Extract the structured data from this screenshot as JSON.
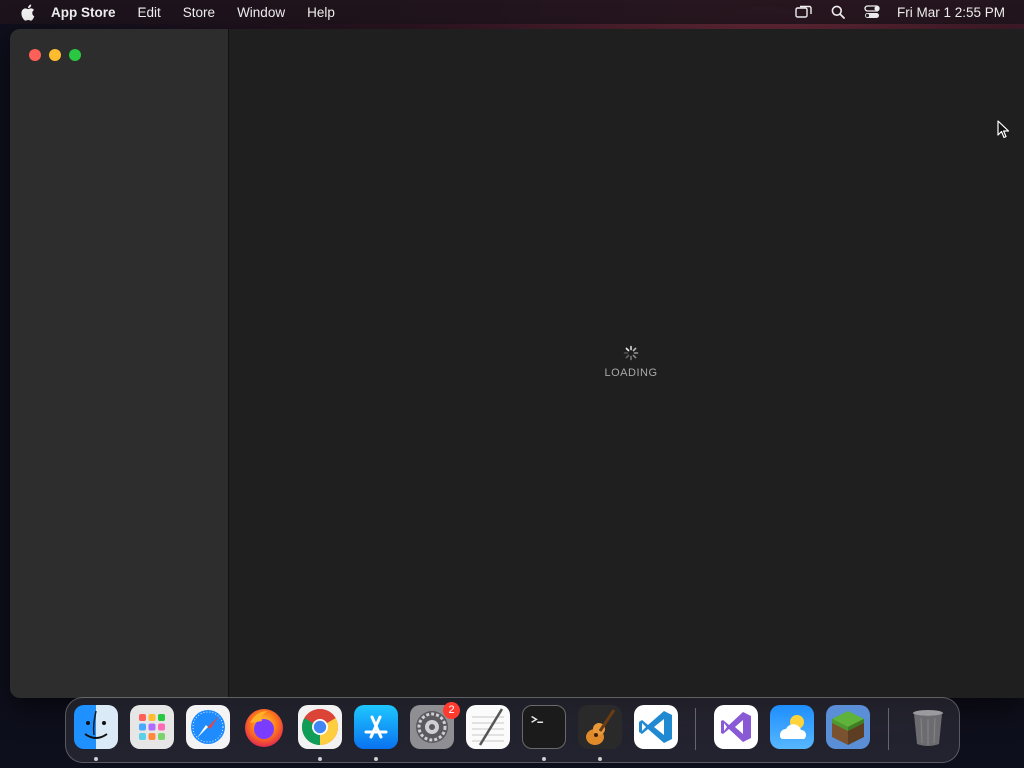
{
  "menubar": {
    "app_name": "App Store",
    "items": [
      "Edit",
      "Store",
      "Window",
      "Help"
    ],
    "clock": "Fri Mar 1  2:55 PM"
  },
  "window": {
    "loading_text": "LOADING"
  },
  "dock": {
    "items": [
      {
        "name": "finder-icon",
        "running": true
      },
      {
        "name": "launchpad-icon",
        "running": false
      },
      {
        "name": "safari-icon",
        "running": false
      },
      {
        "name": "firefox-icon",
        "running": false
      },
      {
        "name": "chrome-icon",
        "running": true
      },
      {
        "name": "app-store-icon",
        "running": true
      },
      {
        "name": "system-settings-icon",
        "running": false,
        "badge": "2"
      },
      {
        "name": "textedit-icon",
        "running": false
      },
      {
        "name": "terminal-icon",
        "running": true
      },
      {
        "name": "garageband-icon",
        "running": true
      },
      {
        "name": "vscode-icon",
        "running": false
      },
      {
        "name": "visual-studio-icon",
        "running": false
      },
      {
        "name": "weather-icon",
        "running": false
      },
      {
        "name": "minecraft-icon",
        "running": false
      },
      {
        "name": "trash-icon",
        "running": false
      }
    ],
    "system_settings_badge": "2"
  },
  "colors": {
    "close": "#fe5f57",
    "minimize": "#febc2e",
    "maximize": "#28c840",
    "badge": "#ff3b30"
  }
}
